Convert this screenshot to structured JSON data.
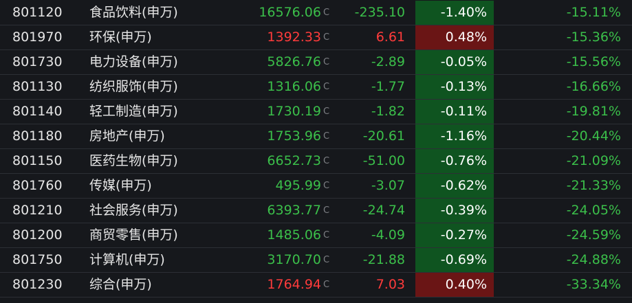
{
  "colors": {
    "up": "#ff3b3b",
    "down": "#3bbf4a",
    "up_box": "#6a1515",
    "down_box": "#0f5420"
  },
  "price_flag": "C",
  "rows": [
    {
      "code": "801120",
      "name": "食品饮料(申万)",
      "price": "16576.06",
      "change": "-235.10",
      "pct": "-1.40%",
      "ytd": "-15.11%",
      "dir": "down"
    },
    {
      "code": "801970",
      "name": "环保(申万)",
      "price": "1392.33",
      "change": "6.61",
      "pct": "0.48%",
      "ytd": "-15.36%",
      "dir": "up"
    },
    {
      "code": "801730",
      "name": "电力设备(申万)",
      "price": "5826.76",
      "change": "-2.89",
      "pct": "-0.05%",
      "ytd": "-15.56%",
      "dir": "down"
    },
    {
      "code": "801130",
      "name": "纺织服饰(申万)",
      "price": "1316.06",
      "change": "-1.77",
      "pct": "-0.13%",
      "ytd": "-16.66%",
      "dir": "down"
    },
    {
      "code": "801140",
      "name": "轻工制造(申万)",
      "price": "1730.19",
      "change": "-1.82",
      "pct": "-0.11%",
      "ytd": "-19.81%",
      "dir": "down"
    },
    {
      "code": "801180",
      "name": "房地产(申万)",
      "price": "1753.96",
      "change": "-20.61",
      "pct": "-1.16%",
      "ytd": "-20.44%",
      "dir": "down"
    },
    {
      "code": "801150",
      "name": "医药生物(申万)",
      "price": "6652.73",
      "change": "-51.00",
      "pct": "-0.76%",
      "ytd": "-21.09%",
      "dir": "down"
    },
    {
      "code": "801760",
      "name": "传媒(申万)",
      "price": "495.99",
      "change": "-3.07",
      "pct": "-0.62%",
      "ytd": "-21.33%",
      "dir": "down"
    },
    {
      "code": "801210",
      "name": "社会服务(申万)",
      "price": "6393.77",
      "change": "-24.74",
      "pct": "-0.39%",
      "ytd": "-24.05%",
      "dir": "down"
    },
    {
      "code": "801200",
      "name": "商贸零售(申万)",
      "price": "1485.06",
      "change": "-4.09",
      "pct": "-0.27%",
      "ytd": "-24.59%",
      "dir": "down"
    },
    {
      "code": "801750",
      "name": "计算机(申万)",
      "price": "3170.70",
      "change": "-21.88",
      "pct": "-0.69%",
      "ytd": "-24.88%",
      "dir": "down"
    },
    {
      "code": "801230",
      "name": "综合(申万)",
      "price": "1764.94",
      "change": "7.03",
      "pct": "0.40%",
      "ytd": "-33.34%",
      "dir": "up"
    }
  ]
}
